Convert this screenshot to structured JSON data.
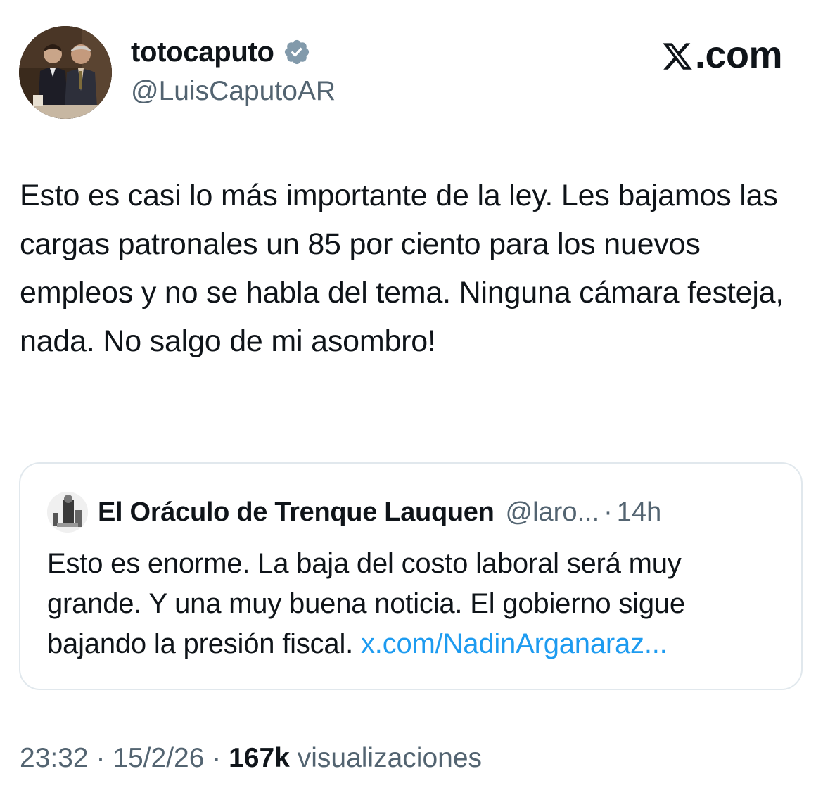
{
  "author": {
    "display_name": "totocaputo",
    "handle": "@LuisCaputoAR",
    "verified_icon": "verified-badge-icon",
    "avatar": "profile-photo"
  },
  "brand": {
    "label": ".com",
    "logo_icon": "x-logo-icon"
  },
  "tweet": {
    "text": "Esto es casi lo más importante de la ley. Les bajamos las cargas patronales un 85 por ciento para los nuevos empleos y no se habla del tema. Ninguna cámara festeja, nada. No salgo de mi asombro!"
  },
  "quoted_tweet": {
    "display_name": "El Oráculo de Trenque Lauquen",
    "handle": "@laro...",
    "separator": "·",
    "time": "14h",
    "text": "Esto es enorme. La baja del costo laboral será muy grande. Y una muy buena noticia. El gobierno sigue bajando la presión fiscal. ",
    "link": "x.com/NadinArganaraz..."
  },
  "footer": {
    "time": "23:32",
    "sep1": "·",
    "date": "15/2/26",
    "sep2": "·",
    "views_count": "167k",
    "views_label": "visualizaciones"
  },
  "colors": {
    "text": "#0f1419",
    "secondary": "#536471",
    "link": "#1d9bf0",
    "border": "#e1e8ed",
    "verified": "#829aab"
  }
}
